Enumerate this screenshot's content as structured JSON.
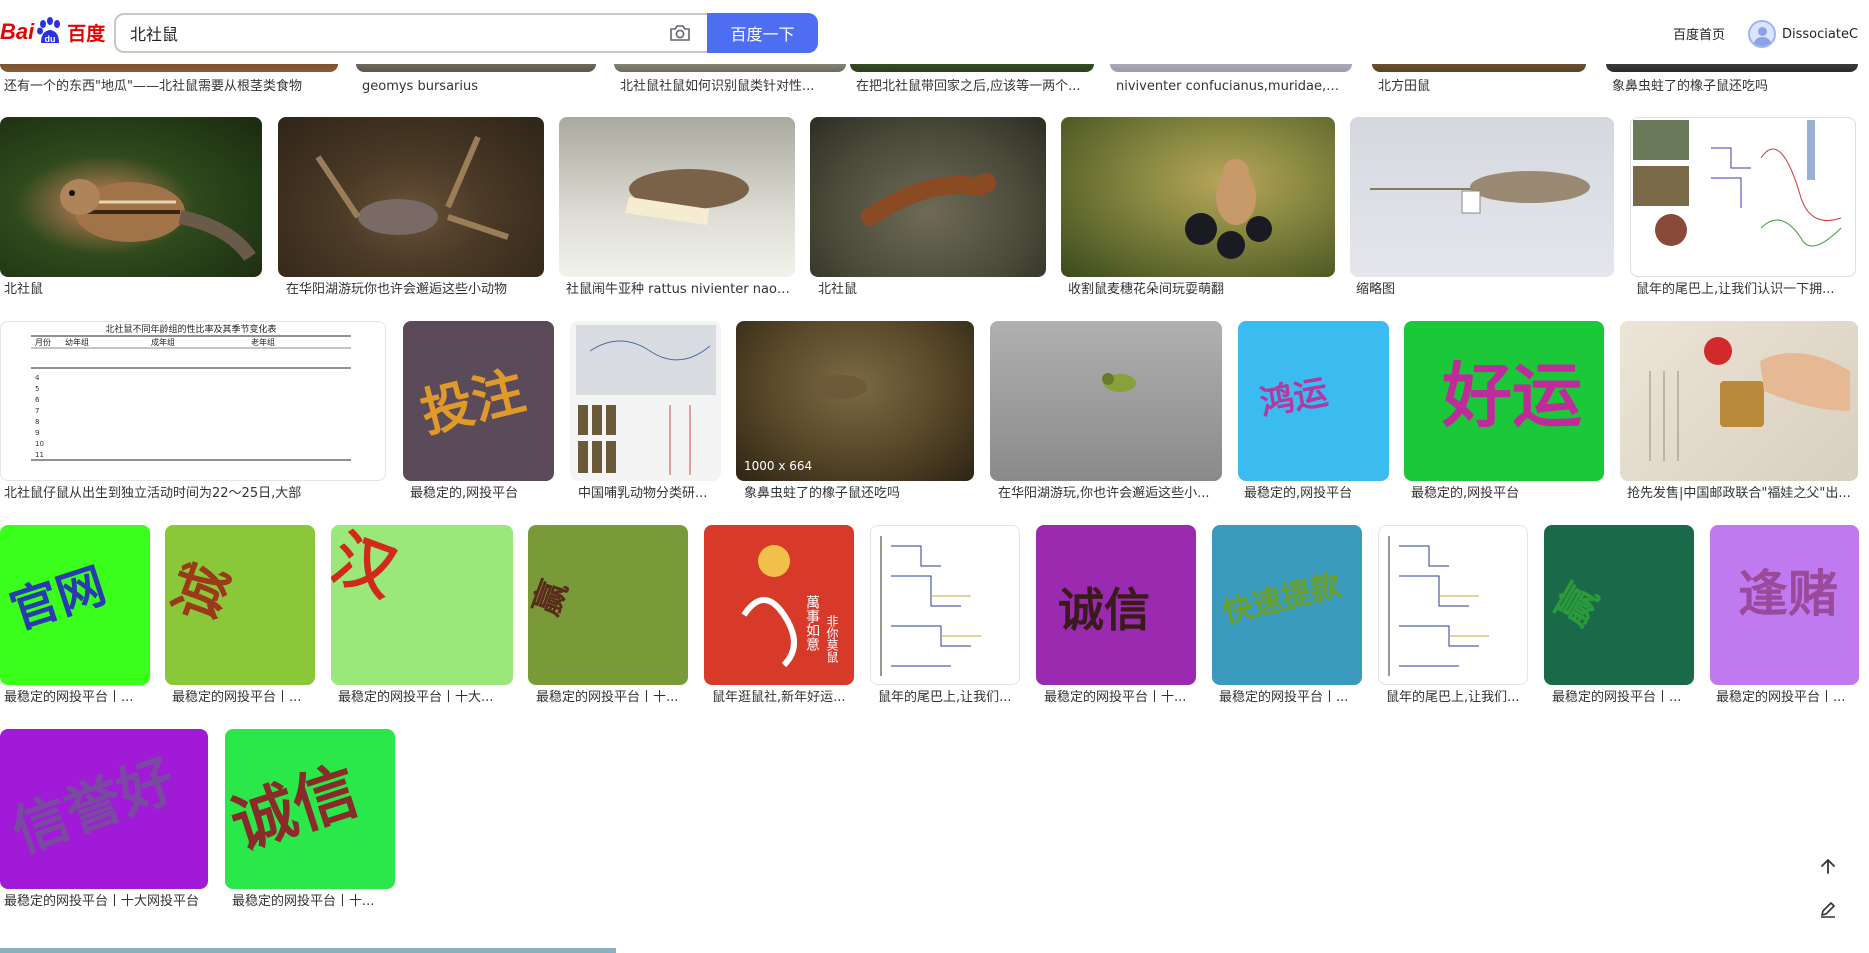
{
  "logo": {
    "text_latin": "Bai",
    "text_du": "du",
    "text_cn": "百度"
  },
  "search": {
    "query": "北社鼠",
    "button_label": "百度一下"
  },
  "header_links": {
    "home": "百度首页",
    "user_name": "DissociateC"
  },
  "rows": [
    {
      "captions": [
        "还有一个的东西\"地瓜\"——北社鼠需要从根茎类食物",
        "geomys bursarius",
        "北社鼠社鼠如何识别鼠类针对性...",
        "在把北社鼠带回家之后,应该等一两个...",
        "niviventer confucianus,muridae,北社...",
        "北方田鼠",
        "象鼻虫蛀了的橡子鼠还吃吗"
      ]
    },
    {
      "captions": [
        "北社鼠",
        "在华阳湖游玩你也许会邂逅这些小动物",
        "社鼠闹牛亚种 rattus nivienter naoni...",
        "北社鼠",
        "收割鼠麦穗花朵间玩耍萌翻",
        "缩略图",
        "鼠年的尾巴上,让我们认识一下拥..."
      ]
    },
    {
      "captions": [
        "北社鼠仔鼠从出生到独立活动时间为22～25日,大部",
        "最稳定的,网投平台",
        "中国哺乳动物分类研...",
        "象鼻虫蛀了的橡子鼠还吃吗",
        "在华阳湖游玩,你也许会邂逅这些小...",
        "最稳定的,网投平台",
        "最稳定的,网投平台",
        "抢先发售|中国邮政联合\"福娃之父\"出..."
      ],
      "dims_label": "1000 x 664",
      "poster_words": [
        "投注",
        "鸿运",
        "好运"
      ]
    },
    {
      "captions": [
        "最稳定的网投平台丨...",
        "最稳定的网投平台丨...",
        "最稳定的网投平台丨十大...",
        "最稳定的网投平台丨十...",
        "鼠年逛鼠社,新年好运...",
        "鼠年的尾巴上,让我们...",
        "最稳定的网投平台丨十...",
        "最稳定的网投平台丨...",
        "鼠年的尾巴上,让我们...",
        "最稳定的网投平台丨...",
        "最稳定的网投平台丨..."
      ],
      "poster_words": [
        "官网",
        "诚",
        "汉",
        "赢",
        "诚信",
        "快速提款",
        "赢",
        "逢赌"
      ]
    },
    {
      "captions": [
        "最稳定的网投平台丨十大网投平台",
        "最稳定的网投平台丨十..."
      ],
      "poster_words": [
        "信誉好",
        "诚信"
      ]
    }
  ],
  "table_image": {
    "title": "北社鼠不同年龄组的性比率及其季节变化表",
    "headers": [
      "月份",
      "幼年组",
      "成年组",
      "老年组"
    ]
  },
  "stamp_text": [
    "萬事如意",
    "非你莫鼠"
  ],
  "colors": {
    "accent": "#4e6ef2",
    "logo_red": "#e10601"
  }
}
